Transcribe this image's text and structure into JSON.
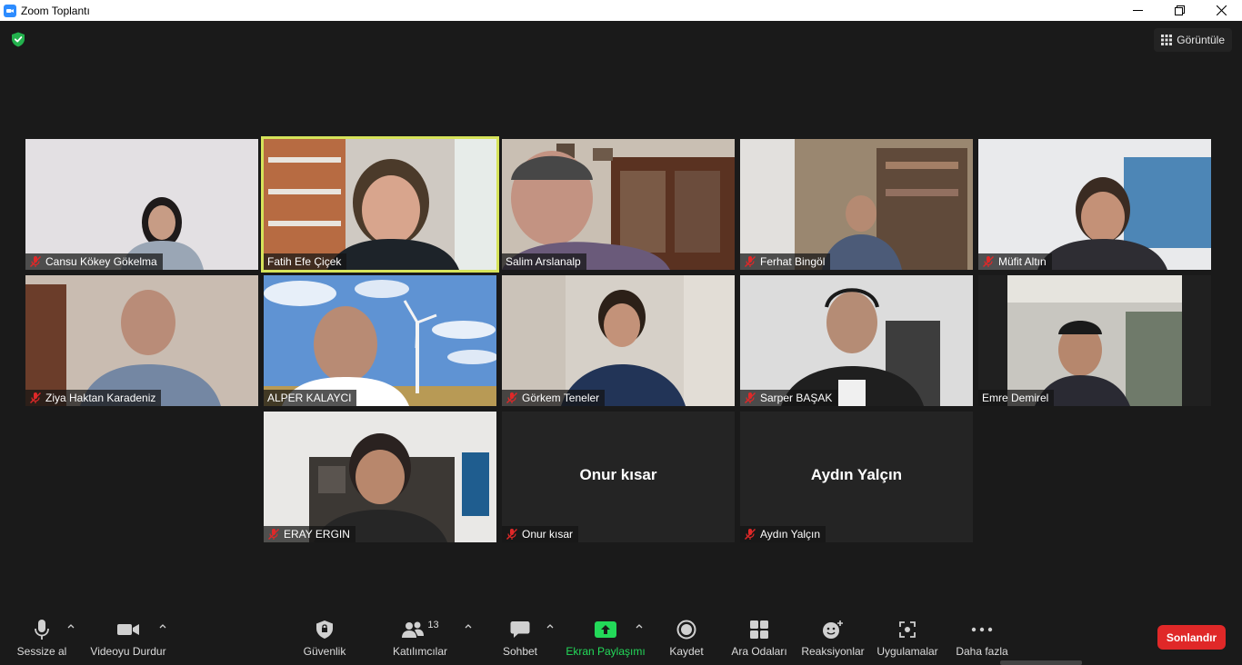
{
  "window": {
    "title": "Zoom Toplantı"
  },
  "header": {
    "view_label": "Görüntüle"
  },
  "participants": [
    {
      "name": "Cansu Kökey Gökelma",
      "muted": true
    },
    {
      "name": "Fatih Efe Çiçek",
      "muted": false,
      "active_speaker": true
    },
    {
      "name": "Salim Arslanalp",
      "muted": false
    },
    {
      "name": "Ferhat Bingöl",
      "muted": true
    },
    {
      "name": "Müfit Altın",
      "muted": true
    },
    {
      "name": "Ziya Haktan Karadeniz",
      "muted": true
    },
    {
      "name": "ALPER KALAYCI",
      "muted": false
    },
    {
      "name": "Görkem Teneler",
      "muted": true
    },
    {
      "name": "Sarper BAŞAK",
      "muted": true
    },
    {
      "name": "Emre Demirel",
      "muted": false
    },
    {
      "name": "ERAY ERGIN",
      "muted": true
    },
    {
      "name": "Onur kısar",
      "muted": true,
      "video_off": true
    },
    {
      "name": "Aydın Yalçın",
      "muted": true,
      "video_off": true
    }
  ],
  "toolbar": {
    "mute_label": "Sessize al",
    "video_label": "Videoyu Durdur",
    "security_label": "Güvenlik",
    "participants_label": "Katılımcılar",
    "participants_count": "13",
    "chat_label": "Sohbet",
    "share_label": "Ekran Paylaşımı",
    "record_label": "Kaydet",
    "breakout_label": "Ara Odaları",
    "reactions_label": "Reaksiyonlar",
    "apps_label": "Uygulamalar",
    "more_label": "Daha fazla",
    "end_label": "Sonlandır"
  },
  "colors": {
    "background": "#1a1a1a",
    "active_speaker_border": "#d6e35a",
    "end_button": "#e02828",
    "share_green": "#23d959",
    "muted_red": "#e02828"
  }
}
